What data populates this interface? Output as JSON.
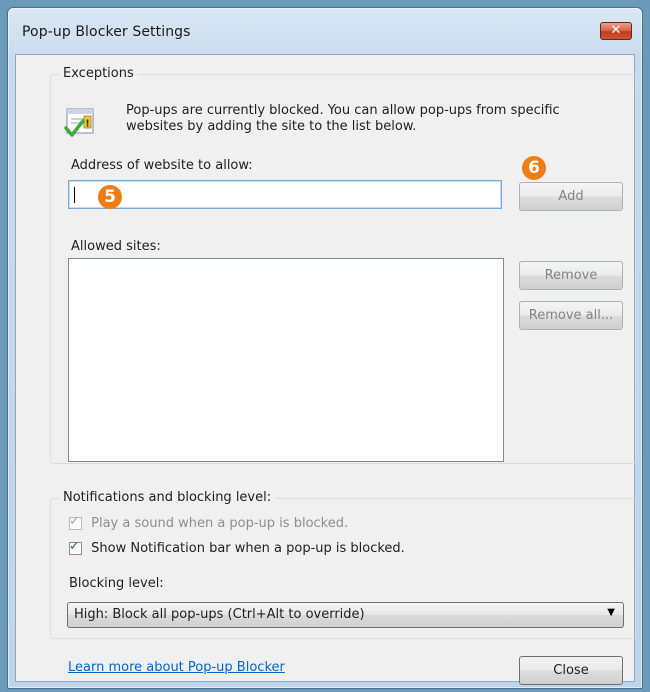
{
  "window": {
    "title": "Pop-up Blocker Settings",
    "close_glyph": "✕"
  },
  "exceptions": {
    "legend": "Exceptions",
    "info_icon": "popup-check-icon",
    "info_line1": "Pop-ups are currently blocked.  You can allow pop-ups from specific",
    "info_line2": "websites by adding the site to the list below.",
    "address_label": "Address of website to allow:",
    "address_value": "",
    "add_label": "Add",
    "allowed_label": "Allowed sites:",
    "allowed_sites": [],
    "remove_label": "Remove",
    "remove_all_label": "Remove all..."
  },
  "annotations": {
    "badge_5": "5",
    "badge_6": "6",
    "badge_color": "#f07d14"
  },
  "notifications": {
    "legend": "Notifications and blocking level:",
    "play_sound_label": "Play a sound when a pop-up is blocked.",
    "play_sound_checked": true,
    "play_sound_enabled": false,
    "show_bar_label": "Show Notification bar when a pop-up is blocked.",
    "show_bar_checked": true,
    "blocking_level_label": "Blocking level:",
    "blocking_level_value": "High: Block all pop-ups (Ctrl+Alt to override)"
  },
  "footer": {
    "learn_more_link": "Learn more about Pop-up Blocker",
    "close_label": "Close"
  }
}
